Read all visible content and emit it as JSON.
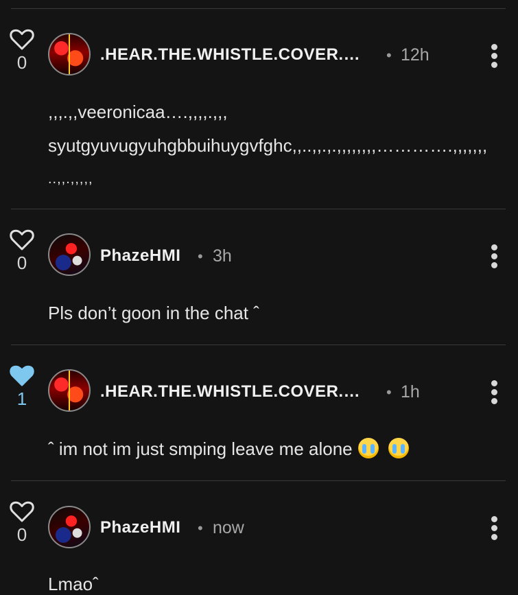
{
  "colors": {
    "background": "#141414",
    "divider": "#3a3a3a",
    "liked_heart": "#7ec8f0",
    "text": "#e6e6e6",
    "muted": "#a8a8a8"
  },
  "comments": [
    {
      "likes": "0",
      "liked": false,
      "author": ".HEAR.THE.WHISTLE.COVER.…",
      "dot": "•",
      "time": "12h",
      "lines": [
        ",,,.,,veeronicaa….,,,,.,,,",
        "syutgyuvugyuhgbbuihuygvfghc,,..,,.,.,,,,,,,,………….,,,,,,,",
        "..,,.,,,,,"
      ]
    },
    {
      "likes": "0",
      "liked": false,
      "author": "PhazeHMI",
      "dot": "•",
      "time": "3h",
      "lines": [
        "Pls don’t goon in the chat ˆ"
      ]
    },
    {
      "likes": "1",
      "liked": true,
      "author": ".HEAR.THE.WHISTLE.COVER.…",
      "dot": "•",
      "time": "1h",
      "lines": [
        "ˆ im not im just smping leave me alone"
      ],
      "emojis": [
        "loudly-crying-face",
        "loudly-crying-face"
      ]
    },
    {
      "likes": "0",
      "liked": false,
      "author": "PhazeHMI",
      "dot": "•",
      "time": "now",
      "lines": [
        "Lmaoˆ"
      ]
    }
  ]
}
